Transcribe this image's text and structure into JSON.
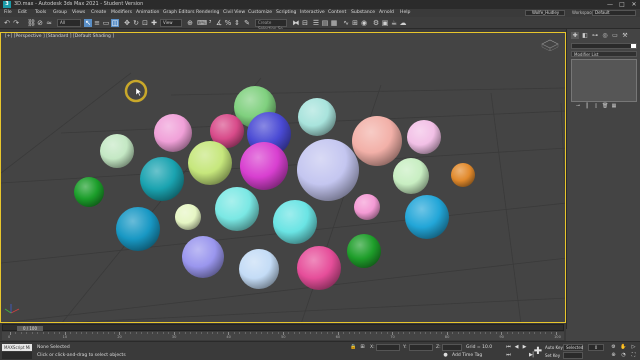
{
  "app": {
    "title": "3D.max - Autodesk 3ds Max 2021 - Student Version",
    "logo_text": "3",
    "window_buttons": [
      "—",
      "□",
      "✕"
    ]
  },
  "menu": {
    "items": [
      "File",
      "Edit",
      "Tools",
      "Group",
      "Views",
      "Create",
      "Modifiers",
      "Animation",
      "Graph Editors",
      "Rendering",
      "Civil View",
      "Customize",
      "Scripting",
      "Interactive",
      "Content",
      "Substance",
      "Arnold",
      "Help"
    ],
    "signin_label": "Wolfe_Hudley",
    "workspaces_label": "Workspaces:",
    "workspaces_value": "Default"
  },
  "toolbar": {
    "filter_value": "All",
    "view_value": "View",
    "selection_set_placeholder": "Create Selection Se"
  },
  "viewport": {
    "label": "[+] [Perspective ] [Standard ] [Default Shading ]",
    "spheres": [
      {
        "color": "#7fd07e",
        "label": "sphere"
      },
      {
        "color": "#a8e3dc",
        "label": "sphere"
      },
      {
        "color": "#f0a0d8",
        "label": "sphere"
      },
      {
        "color": "#d84b8a",
        "label": "sphere"
      },
      {
        "color": "#4a4ad4",
        "label": "sphere"
      },
      {
        "color": "#f2b0a8",
        "label": "sphere"
      },
      {
        "color": "#f2c0e6",
        "label": "sphere"
      },
      {
        "color": "#c4e8c4",
        "label": "sphere"
      },
      {
        "color": "#1aa3b0",
        "label": "sphere"
      },
      {
        "color": "#c6e77c",
        "label": "sphere"
      },
      {
        "color": "#d83fd0",
        "label": "sphere"
      },
      {
        "color": "#c4c6f0",
        "label": "sphere"
      },
      {
        "color": "#c8eec2",
        "label": "sphere"
      },
      {
        "color": "#e28a2c",
        "label": "sphere"
      },
      {
        "color": "#1b9e2a",
        "label": "sphere"
      },
      {
        "color": "#7ae8e4",
        "label": "sphere"
      },
      {
        "color": "#6ae4e4",
        "label": "sphere"
      },
      {
        "color": "#f49ad4",
        "label": "sphere"
      },
      {
        "color": "#e6f6c4",
        "label": "sphere"
      },
      {
        "color": "#1898c4",
        "label": "sphere"
      },
      {
        "color": "#22a6d8",
        "label": "sphere"
      },
      {
        "color": "#9a96ee",
        "label": "sphere"
      },
      {
        "color": "#c4dcf6",
        "label": "sphere"
      },
      {
        "color": "#e64e9a",
        "label": "sphere"
      },
      {
        "color": "#1e9e2a",
        "label": "sphere"
      }
    ]
  },
  "command_panel": {
    "modifier_list_label": "Modifier List"
  },
  "timeline": {
    "thumb_label": "0 / 100",
    "ticks": [
      "0",
      "10",
      "20",
      "30",
      "40",
      "50",
      "60",
      "70",
      "80",
      "90",
      "100"
    ]
  },
  "status": {
    "maxscript_label": "MAXScript Mi",
    "selection": "None Selected",
    "prompt": "Click or click-and-drag to select objects",
    "x_label": "X:",
    "y_label": "Y:",
    "z_label": "Z:",
    "grid": "Grid = 10.0",
    "add_time_tag": "Add Time Tag",
    "auto_key": "Auto Key",
    "set_key": "Set Key",
    "selected_value": "Selected",
    "frame_value": "0"
  },
  "colors": {
    "viewport_bg": "#444444",
    "active_border": "#e8c62c",
    "accent": "#5a8fc7"
  }
}
